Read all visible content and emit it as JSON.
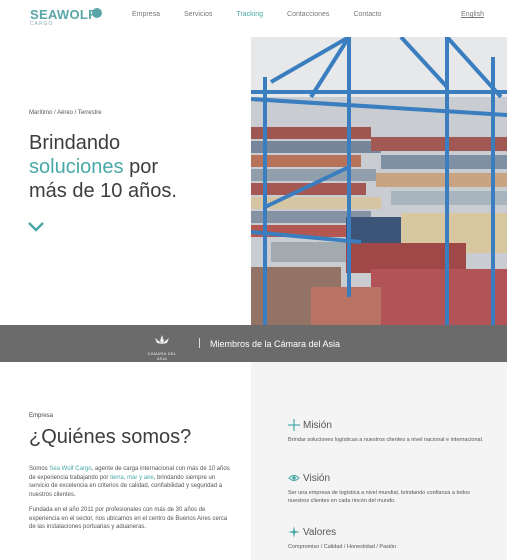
{
  "header": {
    "logo_main": "SEAWOLF",
    "logo_sub": "CARGO",
    "nav": [
      {
        "label": "Empresa",
        "active": false
      },
      {
        "label": "Servicios",
        "active": false
      },
      {
        "label": "Tracking",
        "active": true
      },
      {
        "label": "Contacciones",
        "active": false
      },
      {
        "label": "Contacto",
        "active": false
      }
    ],
    "language": "English"
  },
  "hero": {
    "breadcrumb": "Marítimo / Aéreo / Terrestre",
    "title_part1": "Brindando",
    "title_accent": "soluciones",
    "title_part2": "por",
    "title_part3": "más de 10 años."
  },
  "band": {
    "logo_caption": "CÁMARA DEL ASIA",
    "text": "Miembros de la Cámara del Asia"
  },
  "about": {
    "label": "Empresa",
    "title": "¿Quiénes somos?",
    "p1_a": "Somos ",
    "p1_company": "Sea Wolf Cargo",
    "p1_b": ", agente de carga internacional con más de 10 años de experiencia trabajando por ",
    "p1_modes": "tierra, mar y aire",
    "p1_c": ", brindando siempre un servicio de excelencia en criterios de calidad, confiabilidad y seguridad a nuestros clientes.",
    "p2": "Fundada en el año 2011 por profesionales con más de 30 años de experiencia en el sector, nos ubicamos en el centro de Buenos Aires cerca de las instalaciones portuarias y aduaneras."
  },
  "features": [
    {
      "title": "Misión",
      "text": "Brindar soluciones logísticas a nuestros clientes a nivel nacional e internacional."
    },
    {
      "title": "Visión",
      "text": "Ser una empresa de logística a nivel mundial, brindando confianza a todos nuestros clientes en cada rincón del mundo."
    },
    {
      "title": "Valores",
      "text": "Compromiso / Calidad / Honestidad / Pasión"
    }
  ],
  "colors": {
    "accent": "#48a9a6",
    "band": "#6b6b6b",
    "panel": "#f4f4f4"
  }
}
